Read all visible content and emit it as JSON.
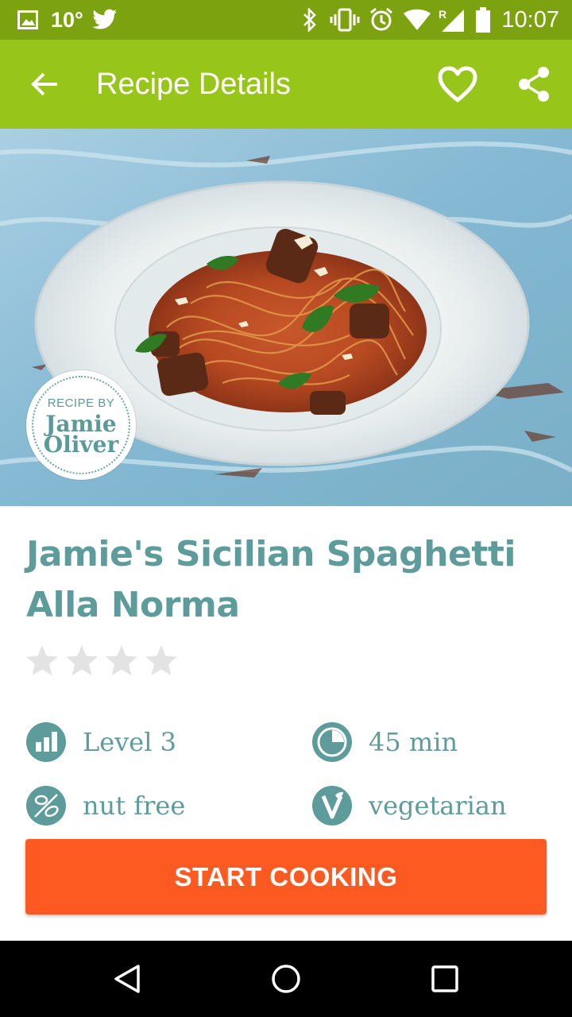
{
  "status_bar": {
    "temperature": "10°",
    "time": "10:07"
  },
  "app_bar": {
    "title": "Recipe Details"
  },
  "hero": {
    "badge_top": "RECIPE BY",
    "badge_name_line1": "Jamie",
    "badge_name_line2": "Oliver"
  },
  "recipe": {
    "title": "Jamie's Sicilian Spaghetti Alla Norma",
    "rating": 0,
    "rating_max": 4,
    "attributes": {
      "level": "Level 3",
      "time": "45 min",
      "diet1": "nut free",
      "diet2": "vegetarian"
    }
  },
  "actions": {
    "start_label": "START COOKING"
  },
  "colors": {
    "status_bar": "#7ca20f",
    "app_bar": "#97c51a",
    "accent_teal": "#5d9c9a",
    "button_orange": "#fc5a21",
    "star_empty": "#e3e3e3"
  }
}
